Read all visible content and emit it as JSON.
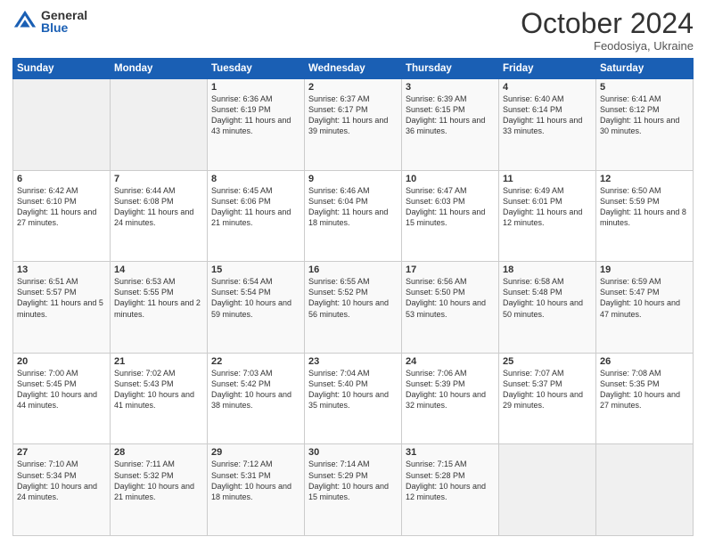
{
  "header": {
    "logo_general": "General",
    "logo_blue": "Blue",
    "month_title": "October 2024",
    "subtitle": "Feodosiya, Ukraine"
  },
  "days_of_week": [
    "Sunday",
    "Monday",
    "Tuesday",
    "Wednesday",
    "Thursday",
    "Friday",
    "Saturday"
  ],
  "weeks": [
    [
      null,
      null,
      {
        "day": "1",
        "sunrise": "Sunrise: 6:36 AM",
        "sunset": "Sunset: 6:19 PM",
        "daylight": "Daylight: 11 hours and 43 minutes."
      },
      {
        "day": "2",
        "sunrise": "Sunrise: 6:37 AM",
        "sunset": "Sunset: 6:17 PM",
        "daylight": "Daylight: 11 hours and 39 minutes."
      },
      {
        "day": "3",
        "sunrise": "Sunrise: 6:39 AM",
        "sunset": "Sunset: 6:15 PM",
        "daylight": "Daylight: 11 hours and 36 minutes."
      },
      {
        "day": "4",
        "sunrise": "Sunrise: 6:40 AM",
        "sunset": "Sunset: 6:14 PM",
        "daylight": "Daylight: 11 hours and 33 minutes."
      },
      {
        "day": "5",
        "sunrise": "Sunrise: 6:41 AM",
        "sunset": "Sunset: 6:12 PM",
        "daylight": "Daylight: 11 hours and 30 minutes."
      }
    ],
    [
      {
        "day": "6",
        "sunrise": "Sunrise: 6:42 AM",
        "sunset": "Sunset: 6:10 PM",
        "daylight": "Daylight: 11 hours and 27 minutes."
      },
      {
        "day": "7",
        "sunrise": "Sunrise: 6:44 AM",
        "sunset": "Sunset: 6:08 PM",
        "daylight": "Daylight: 11 hours and 24 minutes."
      },
      {
        "day": "8",
        "sunrise": "Sunrise: 6:45 AM",
        "sunset": "Sunset: 6:06 PM",
        "daylight": "Daylight: 11 hours and 21 minutes."
      },
      {
        "day": "9",
        "sunrise": "Sunrise: 6:46 AM",
        "sunset": "Sunset: 6:04 PM",
        "daylight": "Daylight: 11 hours and 18 minutes."
      },
      {
        "day": "10",
        "sunrise": "Sunrise: 6:47 AM",
        "sunset": "Sunset: 6:03 PM",
        "daylight": "Daylight: 11 hours and 15 minutes."
      },
      {
        "day": "11",
        "sunrise": "Sunrise: 6:49 AM",
        "sunset": "Sunset: 6:01 PM",
        "daylight": "Daylight: 11 hours and 12 minutes."
      },
      {
        "day": "12",
        "sunrise": "Sunrise: 6:50 AM",
        "sunset": "Sunset: 5:59 PM",
        "daylight": "Daylight: 11 hours and 8 minutes."
      }
    ],
    [
      {
        "day": "13",
        "sunrise": "Sunrise: 6:51 AM",
        "sunset": "Sunset: 5:57 PM",
        "daylight": "Daylight: 11 hours and 5 minutes."
      },
      {
        "day": "14",
        "sunrise": "Sunrise: 6:53 AM",
        "sunset": "Sunset: 5:55 PM",
        "daylight": "Daylight: 11 hours and 2 minutes."
      },
      {
        "day": "15",
        "sunrise": "Sunrise: 6:54 AM",
        "sunset": "Sunset: 5:54 PM",
        "daylight": "Daylight: 10 hours and 59 minutes."
      },
      {
        "day": "16",
        "sunrise": "Sunrise: 6:55 AM",
        "sunset": "Sunset: 5:52 PM",
        "daylight": "Daylight: 10 hours and 56 minutes."
      },
      {
        "day": "17",
        "sunrise": "Sunrise: 6:56 AM",
        "sunset": "Sunset: 5:50 PM",
        "daylight": "Daylight: 10 hours and 53 minutes."
      },
      {
        "day": "18",
        "sunrise": "Sunrise: 6:58 AM",
        "sunset": "Sunset: 5:48 PM",
        "daylight": "Daylight: 10 hours and 50 minutes."
      },
      {
        "day": "19",
        "sunrise": "Sunrise: 6:59 AM",
        "sunset": "Sunset: 5:47 PM",
        "daylight": "Daylight: 10 hours and 47 minutes."
      }
    ],
    [
      {
        "day": "20",
        "sunrise": "Sunrise: 7:00 AM",
        "sunset": "Sunset: 5:45 PM",
        "daylight": "Daylight: 10 hours and 44 minutes."
      },
      {
        "day": "21",
        "sunrise": "Sunrise: 7:02 AM",
        "sunset": "Sunset: 5:43 PM",
        "daylight": "Daylight: 10 hours and 41 minutes."
      },
      {
        "day": "22",
        "sunrise": "Sunrise: 7:03 AM",
        "sunset": "Sunset: 5:42 PM",
        "daylight": "Daylight: 10 hours and 38 minutes."
      },
      {
        "day": "23",
        "sunrise": "Sunrise: 7:04 AM",
        "sunset": "Sunset: 5:40 PM",
        "daylight": "Daylight: 10 hours and 35 minutes."
      },
      {
        "day": "24",
        "sunrise": "Sunrise: 7:06 AM",
        "sunset": "Sunset: 5:39 PM",
        "daylight": "Daylight: 10 hours and 32 minutes."
      },
      {
        "day": "25",
        "sunrise": "Sunrise: 7:07 AM",
        "sunset": "Sunset: 5:37 PM",
        "daylight": "Daylight: 10 hours and 29 minutes."
      },
      {
        "day": "26",
        "sunrise": "Sunrise: 7:08 AM",
        "sunset": "Sunset: 5:35 PM",
        "daylight": "Daylight: 10 hours and 27 minutes."
      }
    ],
    [
      {
        "day": "27",
        "sunrise": "Sunrise: 7:10 AM",
        "sunset": "Sunset: 5:34 PM",
        "daylight": "Daylight: 10 hours and 24 minutes."
      },
      {
        "day": "28",
        "sunrise": "Sunrise: 7:11 AM",
        "sunset": "Sunset: 5:32 PM",
        "daylight": "Daylight: 10 hours and 21 minutes."
      },
      {
        "day": "29",
        "sunrise": "Sunrise: 7:12 AM",
        "sunset": "Sunset: 5:31 PM",
        "daylight": "Daylight: 10 hours and 18 minutes."
      },
      {
        "day": "30",
        "sunrise": "Sunrise: 7:14 AM",
        "sunset": "Sunset: 5:29 PM",
        "daylight": "Daylight: 10 hours and 15 minutes."
      },
      {
        "day": "31",
        "sunrise": "Sunrise: 7:15 AM",
        "sunset": "Sunset: 5:28 PM",
        "daylight": "Daylight: 10 hours and 12 minutes."
      },
      null,
      null
    ]
  ]
}
